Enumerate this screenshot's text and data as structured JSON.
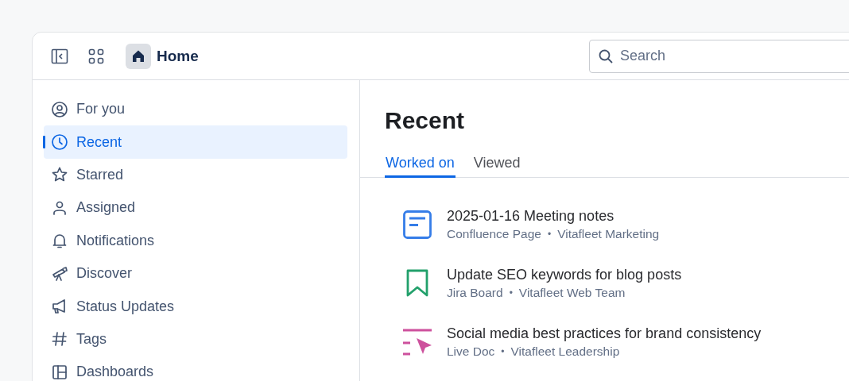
{
  "header": {
    "title": "Home",
    "search": {
      "placeholder": "Search"
    }
  },
  "sidebar": {
    "items": [
      {
        "label": "For you",
        "selected": false
      },
      {
        "label": "Recent",
        "selected": true
      },
      {
        "label": "Starred",
        "selected": false
      },
      {
        "label": "Assigned",
        "selected": false
      },
      {
        "label": "Notifications",
        "selected": false
      },
      {
        "label": "Discover",
        "selected": false
      },
      {
        "label": "Status Updates",
        "selected": false
      },
      {
        "label": "Tags",
        "selected": false
      },
      {
        "label": "Dashboards",
        "selected": false
      }
    ]
  },
  "main": {
    "title": "Recent",
    "tabs": [
      {
        "label": "Worked on",
        "selected": true
      },
      {
        "label": "Viewed",
        "selected": false
      }
    ],
    "items": [
      {
        "title": "2025-01-16 Meeting notes",
        "type": "Confluence Page",
        "separator": "•",
        "space": "Vitafleet Marketing"
      },
      {
        "title": "Update SEO keywords for blog posts",
        "type": "Jira Board",
        "separator": "•",
        "space": "Vitafleet Web Team"
      },
      {
        "title": "Social media best practices for brand consistency",
        "type": "Live Doc",
        "separator": "•",
        "space": "Vitafleet Leadership"
      }
    ]
  }
}
